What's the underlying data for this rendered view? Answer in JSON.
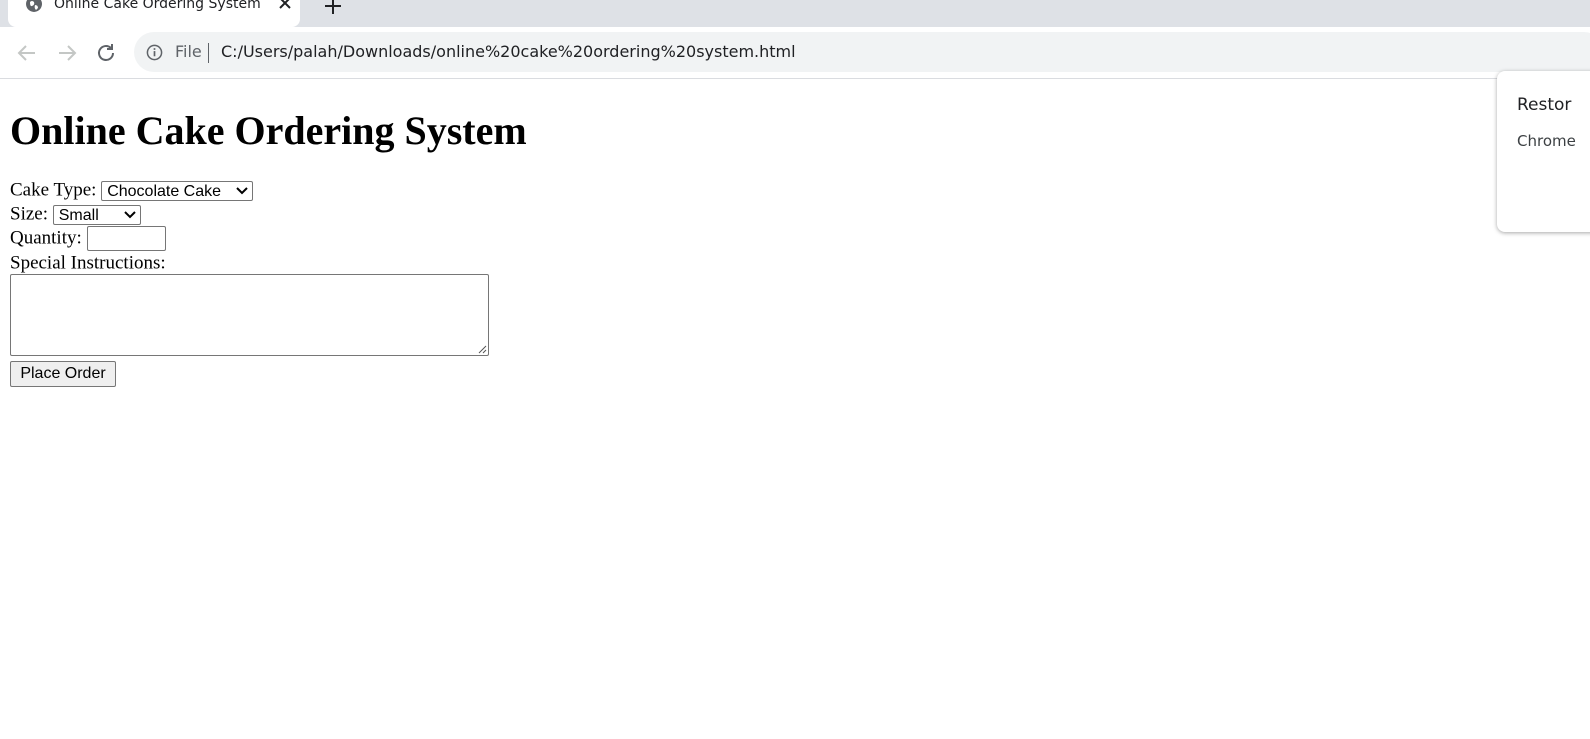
{
  "browser": {
    "tab": {
      "title": "Online Cake Ordering System",
      "favicon": "globe-icon"
    },
    "address_bar": {
      "scheme_label": "File",
      "url": "C:/Users/palah/Downloads/online%20cake%20ordering%20system.html"
    }
  },
  "page": {
    "heading": "Online Cake Ordering System",
    "form": {
      "cake_type_label": "Cake Type:",
      "cake_type_value": "Chocolate Cake",
      "size_label": "Size:",
      "size_value": "Small",
      "quantity_label": "Quantity:",
      "quantity_value": "",
      "instructions_label": "Special Instructions:",
      "instructions_value": "",
      "submit_label": "Place Order"
    }
  },
  "restore_popup": {
    "title": "Restor",
    "body": "Chrome"
  }
}
